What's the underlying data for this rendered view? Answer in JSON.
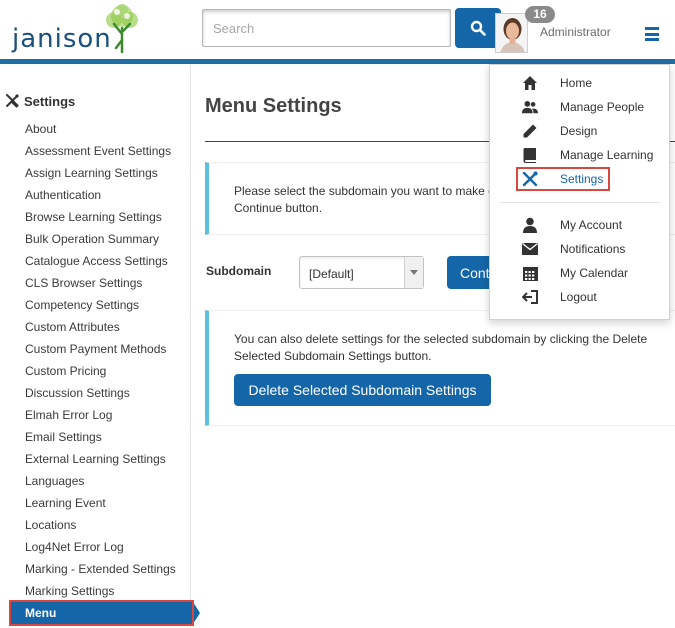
{
  "header": {
    "logo_text": "janison",
    "search_placeholder": "Search",
    "notification_count": "16",
    "user_name": "Administrator"
  },
  "sidebar": {
    "title": "Settings",
    "items": [
      {
        "label": "About"
      },
      {
        "label": "Assessment Event Settings"
      },
      {
        "label": "Assign Learning Settings"
      },
      {
        "label": "Authentication"
      },
      {
        "label": "Browse Learning Settings"
      },
      {
        "label": "Bulk Operation Summary"
      },
      {
        "label": "Catalogue Access Settings"
      },
      {
        "label": "CLS Browser Settings"
      },
      {
        "label": "Competency Settings"
      },
      {
        "label": "Custom Attributes"
      },
      {
        "label": "Custom Payment Methods"
      },
      {
        "label": "Custom Pricing"
      },
      {
        "label": "Discussion Settings"
      },
      {
        "label": "Elmah Error Log"
      },
      {
        "label": "Email Settings"
      },
      {
        "label": "External Learning Settings"
      },
      {
        "label": "Languages"
      },
      {
        "label": "Learning Event"
      },
      {
        "label": "Locations"
      },
      {
        "label": "Log4Net Error Log"
      },
      {
        "label": "Marking - Extended Settings"
      },
      {
        "label": "Marking Settings"
      },
      {
        "label": "Menu"
      }
    ],
    "active_item": "Menu"
  },
  "main": {
    "title": "Menu Settings",
    "info_text": "Please select the subdomain you want to make changes to and then click the Continue button.",
    "subdomain_label": "Subdomain",
    "subdomain_value": "[Default]",
    "continue_label": "Continue",
    "delete_text": "You can also delete settings for the selected subdomain by clicking the Delete Selected Subdomain Settings button.",
    "delete_button_label": "Delete Selected Subdomain Settings"
  },
  "dropdown_menu": {
    "items": [
      {
        "label": "Home",
        "icon": "home-icon"
      },
      {
        "label": "Manage People",
        "icon": "people-icon"
      },
      {
        "label": "Design",
        "icon": "pencil-icon"
      },
      {
        "label": "Manage Learning",
        "icon": "book-icon"
      },
      {
        "label": "Settings",
        "icon": "wrench-icon"
      }
    ],
    "account_items": [
      {
        "label": "My Account",
        "icon": "user-icon"
      },
      {
        "label": "Notifications",
        "icon": "envelope-icon"
      },
      {
        "label": "My Calendar",
        "icon": "calendar-icon"
      },
      {
        "label": "Logout",
        "icon": "logout-icon"
      }
    ],
    "selected_item": "Settings"
  },
  "colors": {
    "primary": "#1566a8",
    "info_accent": "#5bc0de",
    "highlight": "#d9483f"
  }
}
